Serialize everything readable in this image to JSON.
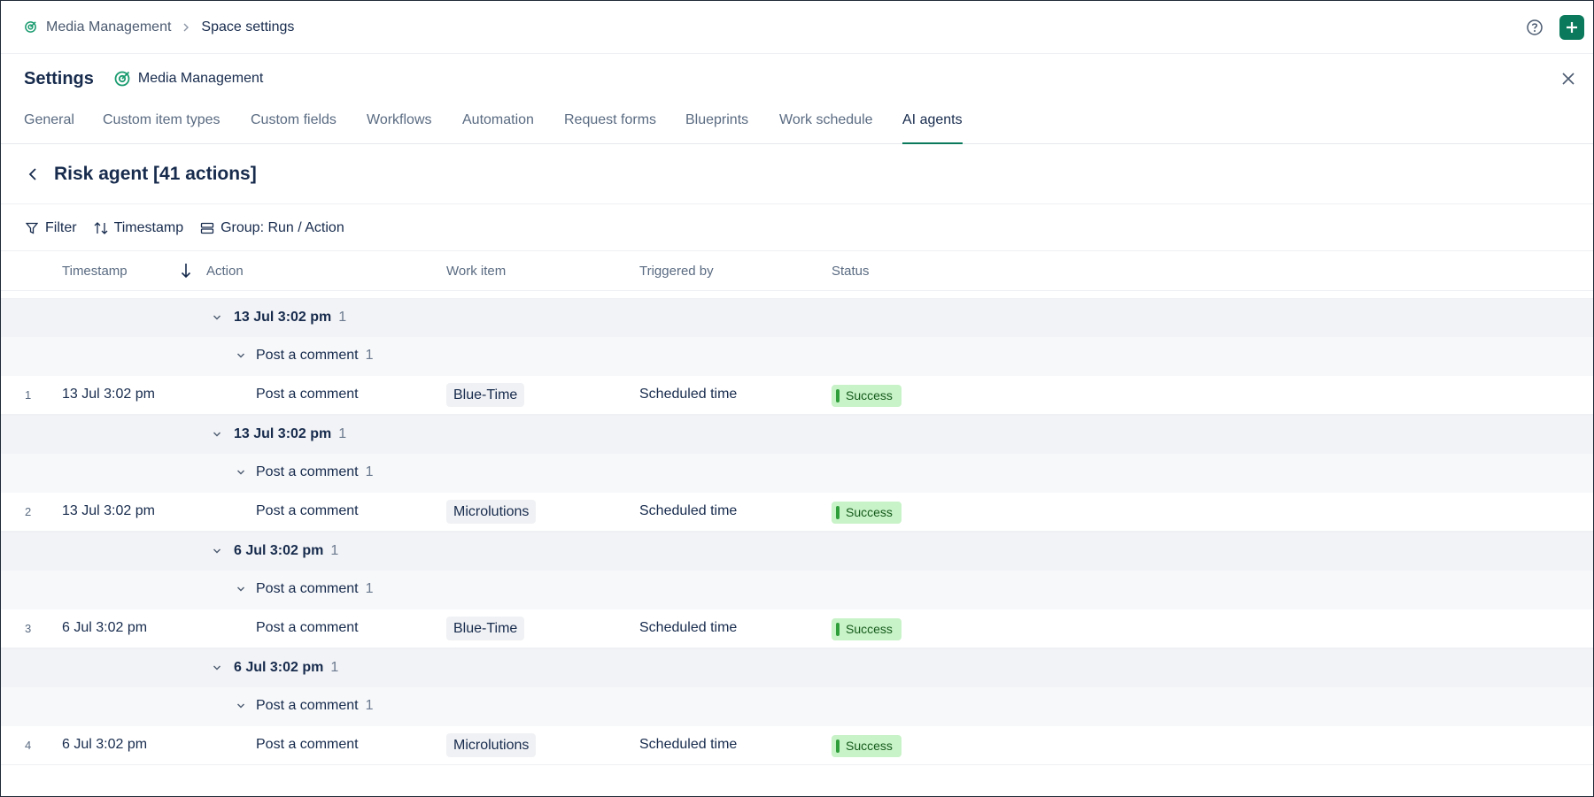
{
  "breadcrumb": {
    "space": "Media Management",
    "current": "Space settings"
  },
  "header": {
    "title": "Settings",
    "space_name": "Media Management"
  },
  "tabs": [
    {
      "label": "General"
    },
    {
      "label": "Custom item types"
    },
    {
      "label": "Custom fields"
    },
    {
      "label": "Workflows"
    },
    {
      "label": "Automation"
    },
    {
      "label": "Request forms"
    },
    {
      "label": "Blueprints"
    },
    {
      "label": "Work schedule"
    },
    {
      "label": "AI agents",
      "active": true
    }
  ],
  "page": {
    "title": "Risk agent [41 actions]"
  },
  "toolbar": {
    "filter": "Filter",
    "sort": "Timestamp",
    "group": "Group: Run / Action"
  },
  "columns": {
    "timestamp": "Timestamp",
    "action": "Action",
    "work_item": "Work item",
    "triggered_by": "Triggered by",
    "status": "Status"
  },
  "groups": [
    {
      "run": "13 Jul 3:02 pm",
      "run_count": "1",
      "action": "Post a comment",
      "action_count": "1",
      "item": {
        "num": "1",
        "timestamp": "13 Jul 3:02 pm",
        "action": "Post a comment",
        "work_item": "Blue-Time",
        "triggered_by": "Scheduled time",
        "status": "Success"
      }
    },
    {
      "run": "13 Jul 3:02 pm",
      "run_count": "1",
      "action": "Post a comment",
      "action_count": "1",
      "item": {
        "num": "2",
        "timestamp": "13 Jul 3:02 pm",
        "action": "Post a comment",
        "work_item": "Microlutions",
        "triggered_by": "Scheduled time",
        "status": "Success"
      }
    },
    {
      "run": "6 Jul 3:02 pm",
      "run_count": "1",
      "action": "Post a comment",
      "action_count": "1",
      "item": {
        "num": "3",
        "timestamp": "6 Jul 3:02 pm",
        "action": "Post a comment",
        "work_item": "Blue-Time",
        "triggered_by": "Scheduled time",
        "status": "Success"
      }
    },
    {
      "run": "6 Jul 3:02 pm",
      "run_count": "1",
      "action": "Post a comment",
      "action_count": "1",
      "item": {
        "num": "4",
        "timestamp": "6 Jul 3:02 pm",
        "action": "Post a comment",
        "work_item": "Microlutions",
        "triggered_by": "Scheduled time",
        "status": "Success"
      }
    }
  ],
  "colors": {
    "accent": "#0b7a5c",
    "success_bg": "#c8f2c8",
    "success_bar": "#2e9e3a",
    "group_bg": "#f2f3f6"
  }
}
